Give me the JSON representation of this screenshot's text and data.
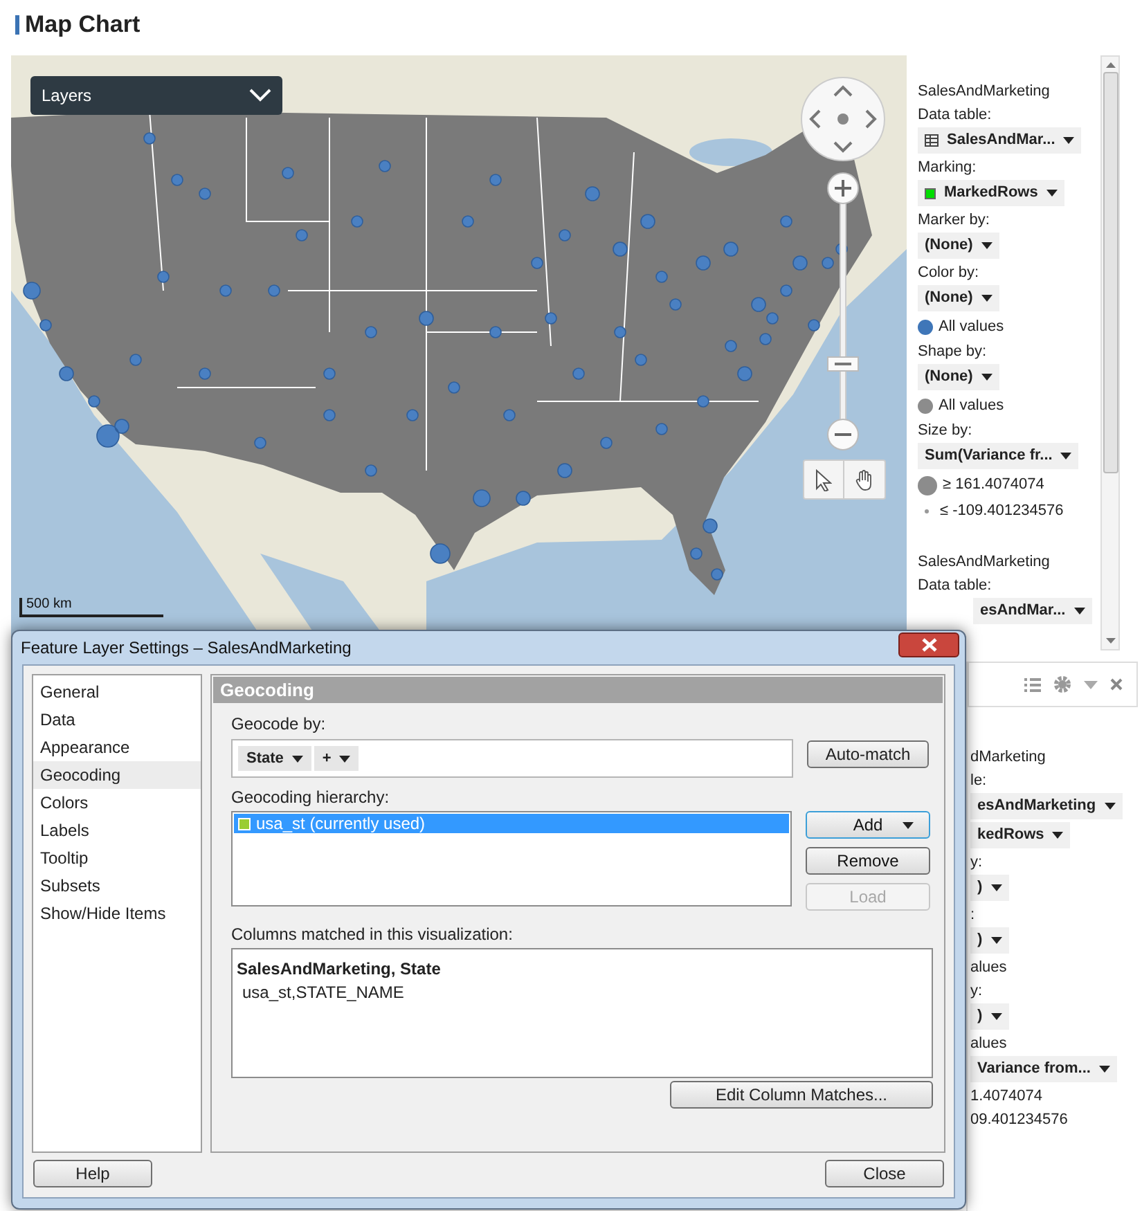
{
  "page_title": "Map Chart",
  "map": {
    "kind": "picture",
    "layers_label": "Layers",
    "scale_label": "500 km"
  },
  "legend": {
    "sections": [
      {
        "items": [
          {
            "kind": "label",
            "text": "SalesAndMarketing"
          },
          {
            "kind": "label",
            "text": "Data table:"
          },
          {
            "kind": "table_dropdown",
            "text": "SalesAndMar..."
          },
          {
            "kind": "label",
            "text": "Marking:"
          },
          {
            "kind": "marking_dropdown",
            "text": "MarkedRows",
            "color": "#00dd00"
          },
          {
            "kind": "label",
            "text": "Marker by:"
          },
          {
            "kind": "dropdown",
            "text": "(None)"
          },
          {
            "kind": "label",
            "text": "Color by:"
          },
          {
            "kind": "dropdown",
            "text": "(None)"
          },
          {
            "kind": "color_entry",
            "text": "All values",
            "color": "#3f76b8"
          },
          {
            "kind": "label",
            "text": "Shape by:"
          },
          {
            "kind": "dropdown",
            "text": "(None)"
          },
          {
            "kind": "color_entry",
            "text": "All values",
            "color": "#8c8c8c"
          },
          {
            "kind": "label",
            "text": "Size by:"
          },
          {
            "kind": "dropdown",
            "text": "Sum(Variance  fr..."
          },
          {
            "kind": "size_max",
            "text": "≥ 161.4074074"
          },
          {
            "kind": "size_min",
            "text": "≤ -109.401234576"
          }
        ]
      },
      {
        "items": [
          {
            "kind": "label",
            "text": "SalesAndMarketing"
          },
          {
            "kind": "label",
            "text": "Data table:"
          },
          {
            "kind": "cut_dropdown",
            "text": "esAndMar..."
          }
        ]
      }
    ]
  },
  "second_panel": {
    "items": [
      {
        "kind": "label",
        "text": "dMarketing"
      },
      {
        "kind": "label",
        "text": "le:"
      },
      {
        "kind": "dropdown",
        "text": "esAndMarketing"
      },
      {
        "kind": "dropdown",
        "text": "kedRows"
      },
      {
        "kind": "label",
        "text": "y:"
      },
      {
        "kind": "dropdown",
        "text": ")"
      },
      {
        "kind": "label",
        "text": ":"
      },
      {
        "kind": "dropdown",
        "text": ")"
      },
      {
        "kind": "label",
        "text": "alues"
      },
      {
        "kind": "label",
        "text": "y:"
      },
      {
        "kind": "dropdown",
        "text": ")"
      },
      {
        "kind": "label",
        "text": "alues"
      },
      {
        "kind": "dropdown",
        "text": "Variance  from..."
      },
      {
        "kind": "label",
        "text": "1.4074074"
      },
      {
        "kind": "label",
        "text": "09.401234576"
      }
    ]
  },
  "dialog": {
    "title": "Feature Layer Settings – SalesAndMarketing",
    "nav_items": [
      {
        "label": "General",
        "selected": false
      },
      {
        "label": "Data",
        "selected": false
      },
      {
        "label": "Appearance",
        "selected": false
      },
      {
        "label": "Geocoding",
        "selected": true
      },
      {
        "label": "Colors",
        "selected": false
      },
      {
        "label": "Labels",
        "selected": false
      },
      {
        "label": "Tooltip",
        "selected": false
      },
      {
        "label": "Subsets",
        "selected": false
      },
      {
        "label": "Show/Hide Items",
        "selected": false
      }
    ],
    "section_title": "Geocoding",
    "geocode_by_label": "Geocode by:",
    "geocode_chips": [
      "State",
      "+"
    ],
    "auto_match": "Auto-match",
    "hierarchy_label": "Geocoding hierarchy:",
    "hierarchy_items": [
      {
        "label": "usa_st (currently used)",
        "selected": true,
        "color": "#9acd32"
      }
    ],
    "side_buttons": [
      {
        "label": "Add",
        "disabled": false,
        "menu": true
      },
      {
        "label": "Remove",
        "disabled": false,
        "menu": false
      },
      {
        "label": "Load",
        "disabled": true,
        "menu": false
      }
    ],
    "matched_label": "Columns matched in this visualization:",
    "matched_heading": "SalesAndMarketing, State",
    "matched_value": "usa_st,STATE_NAME",
    "edit_button": "Edit Column Matches...",
    "help_button": "Help",
    "close_button": "Close"
  }
}
